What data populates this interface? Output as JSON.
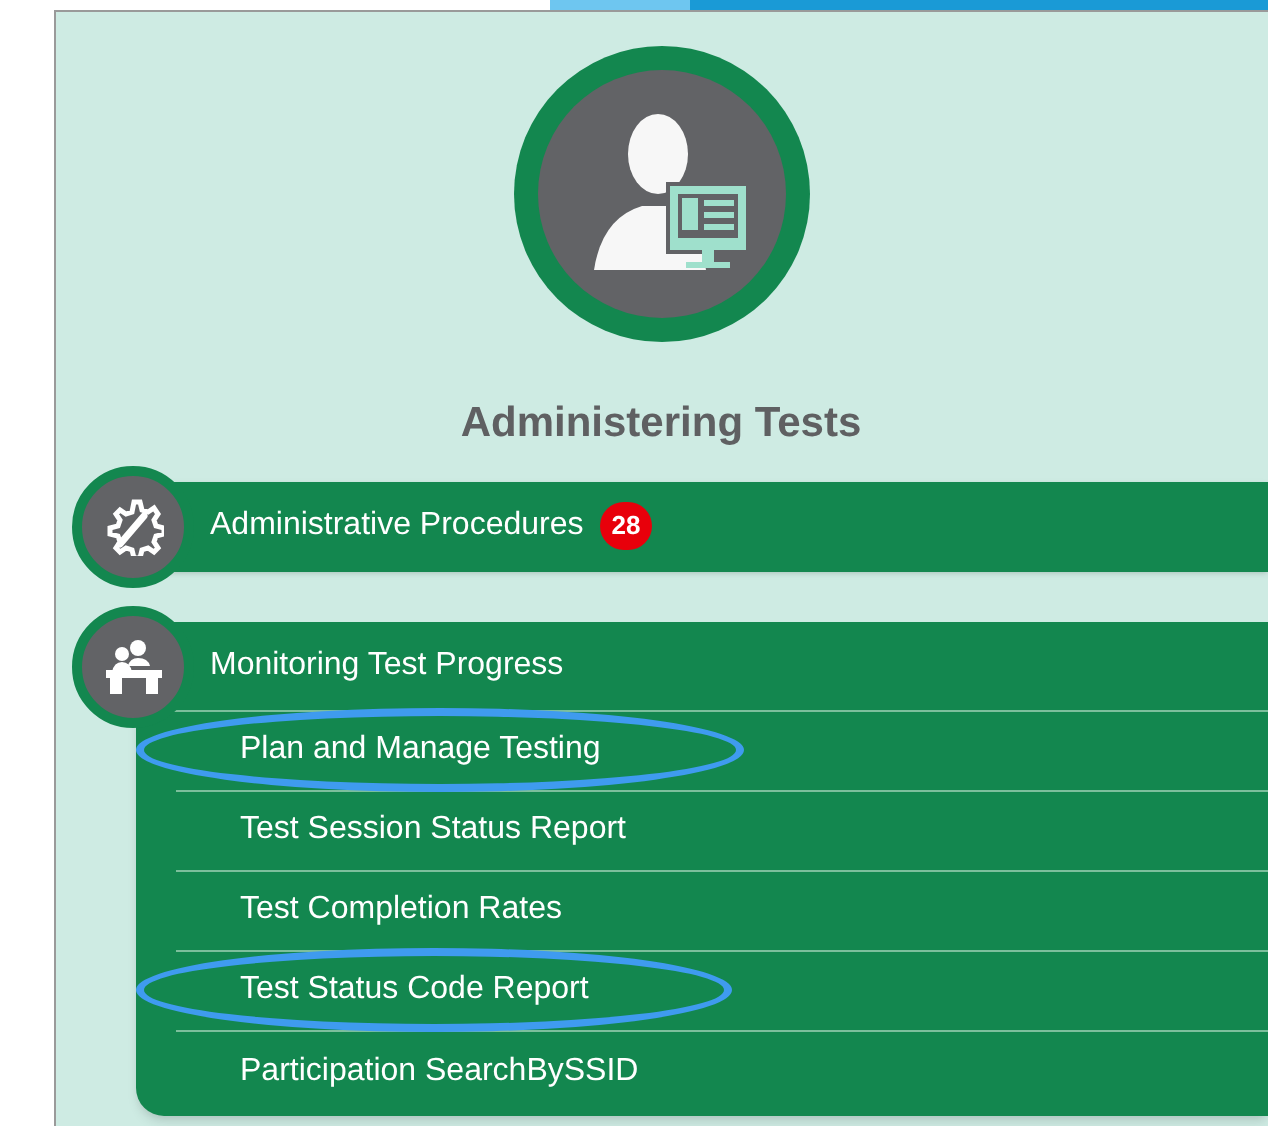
{
  "title": "Administering Tests",
  "sections": [
    {
      "kind": "gear",
      "label": "Administrative Procedures",
      "badge": "28",
      "expanded": false
    },
    {
      "kind": "desk",
      "label": "Monitoring Test Progress",
      "expanded": true,
      "items": [
        {
          "label": "Plan and Manage Testing",
          "circled": true
        },
        {
          "label": "Test Session Status Report",
          "circled": false
        },
        {
          "label": "Test Completion Rates",
          "circled": false
        },
        {
          "label": "Test Status Code Report",
          "circled": true
        },
        {
          "label": "Participation SearchBySSID",
          "circled": false
        }
      ]
    }
  ]
}
